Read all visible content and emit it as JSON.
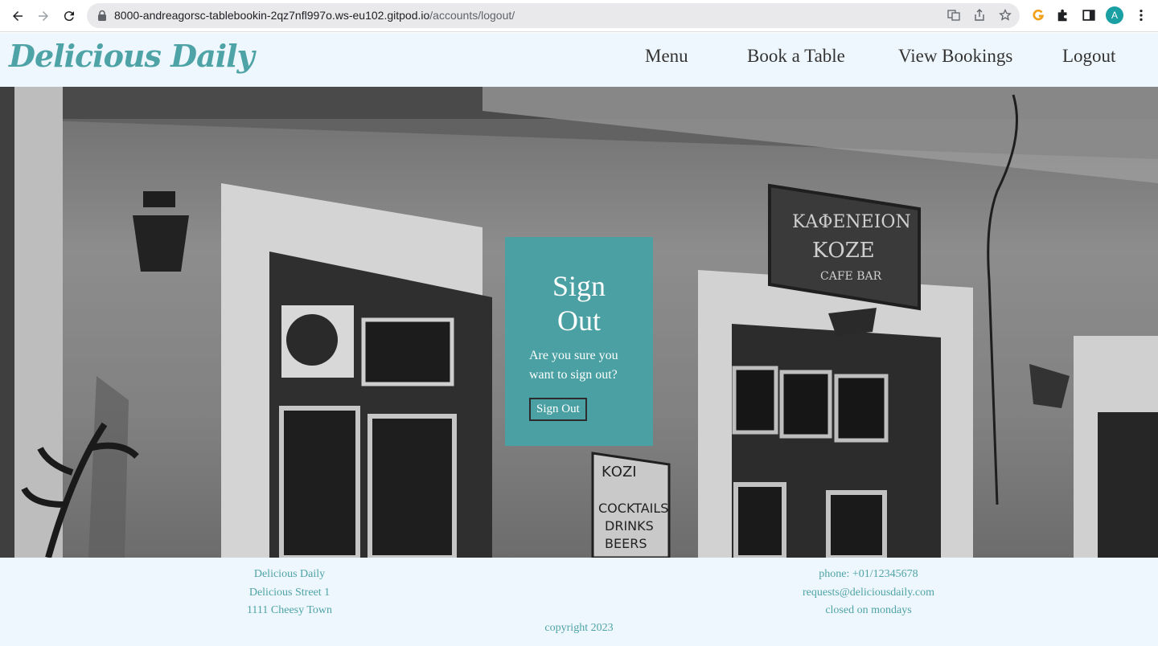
{
  "browser": {
    "url_host": "8000-andreagorsc-tablebookin-2qz7nfl997o.ws-eu102.gitpod.io",
    "url_path": "/accounts/logout/",
    "avatar_letter": "A",
    "icons": [
      "back-icon",
      "forward-icon",
      "reload-icon",
      "lock-icon",
      "translate-icon",
      "share-icon",
      "bookmark-star-icon",
      "grammarly-icon",
      "extensions-puzzle-icon",
      "sidebar-icon",
      "kebab-menu-icon"
    ]
  },
  "header": {
    "brand": "Delicious Daily",
    "nav": [
      {
        "label": "Menu"
      },
      {
        "label": "Book a Table"
      },
      {
        "label": "View Bookings"
      },
      {
        "label": "Logout"
      }
    ]
  },
  "card": {
    "title_line1": "Sign",
    "title_line2": "Out",
    "text": "Are you sure you want to sign out?",
    "button_label": "Sign Out"
  },
  "footer": {
    "left": [
      "Delicious Daily",
      "Delicious Street 1",
      "1111 Cheesy Town"
    ],
    "right": [
      "phone: +01/12345678",
      "requests@deliciousdaily.com",
      "closed on mondays"
    ],
    "copyright": "copyright 2023"
  },
  "colors": {
    "accent": "#4aa0a2",
    "brand": "#4ea3a6",
    "header_bg": "#eef7fd"
  }
}
